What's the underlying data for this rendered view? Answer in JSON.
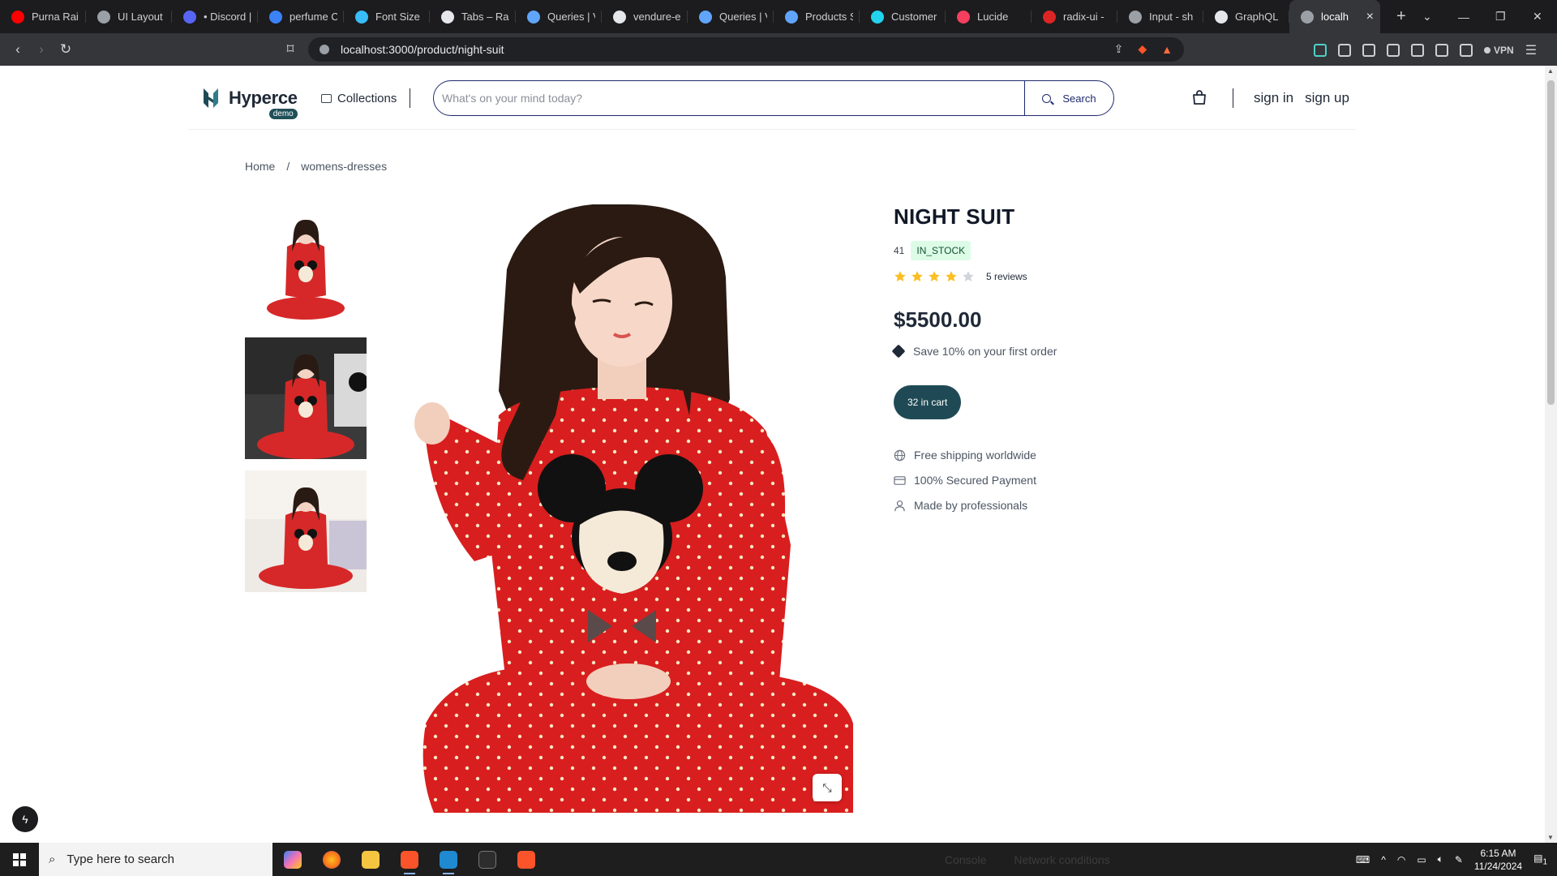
{
  "browser": {
    "tabs": [
      {
        "title": "Purna Rai",
        "color": "#ff0000"
      },
      {
        "title": "UI Layout",
        "color": "#9aa0a6"
      },
      {
        "title": "• Discord |",
        "color": "#5865f2"
      },
      {
        "title": "perfume C",
        "color": "#3b82f6"
      },
      {
        "title": "Font Size",
        "color": "#38bdf8"
      },
      {
        "title": "Tabs – Rad",
        "color": "#e5e7eb"
      },
      {
        "title": "Queries | V",
        "color": "#60a5fa"
      },
      {
        "title": "vendure-e",
        "color": "#e5e7eb"
      },
      {
        "title": "Queries | V",
        "color": "#60a5fa"
      },
      {
        "title": "Products S",
        "color": "#60a5fa"
      },
      {
        "title": "Customer",
        "color": "#22d3ee"
      },
      {
        "title": "Lucide",
        "color": "#f43f5e"
      },
      {
        "title": "radix-ui -",
        "color": "#dc2626"
      },
      {
        "title": "Input - sh",
        "color": "#9aa0a6"
      },
      {
        "title": "GraphQL",
        "color": "#e5e7eb"
      },
      {
        "title": "localh",
        "color": "#9aa0a6",
        "active": true
      }
    ],
    "url": "localhost:3000/product/night-suit",
    "vpn_label": "VPN"
  },
  "header": {
    "logo_name": "Hyperce",
    "logo_badge": "demo",
    "collections_label": "Collections",
    "search_placeholder": "What's on your mind today?",
    "search_button": "Search",
    "sign_in": "sign in",
    "sign_up": "sign up"
  },
  "breadcrumb": {
    "home": "Home",
    "separator": "/",
    "current": "womens-dresses"
  },
  "product": {
    "title": "NIGHT SUIT",
    "stock_count": "41",
    "stock_status": "IN_STOCK",
    "rating": 4,
    "rating_max": 5,
    "reviews_label": "5 reviews",
    "price": "$5500.00",
    "promo": "Save 10% on your first order",
    "cart_button": "32 in cart",
    "features": [
      {
        "label": "Free shipping worldwide",
        "icon": "globe-icon"
      },
      {
        "label": "100% Secured Payment",
        "icon": "credit-card-icon"
      },
      {
        "label": "Made by professionals",
        "icon": "user-icon"
      }
    ],
    "thumbnail_count": 3
  },
  "colors": {
    "accent": "#1f4a55",
    "search_border": "#1f2a6e",
    "star_on": "#fbbf24",
    "star_off": "#d1d5db",
    "stock_badge_bg": "#dcfce7"
  },
  "taskbar": {
    "search_placeholder": "Type here to search",
    "devtools_console": "Console",
    "devtools_network": "Network conditions",
    "time": "6:15 AM",
    "date": "11/24/2024",
    "notification_count": "1"
  }
}
